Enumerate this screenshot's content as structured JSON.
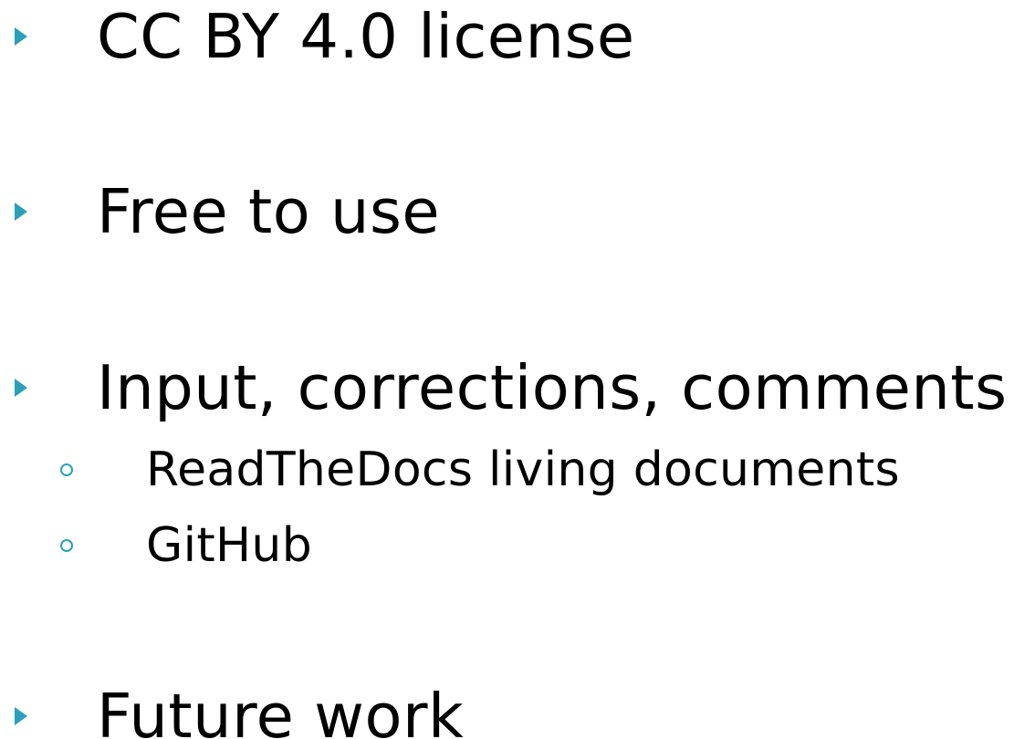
{
  "slide": {
    "bullets": [
      {
        "label": "CC BY 4.0 license"
      },
      {
        "label": "Free to use"
      },
      {
        "label": "Input, corrections, comments",
        "subitems": [
          "ReadTheDocs living documents",
          "GitHub"
        ]
      },
      {
        "label": "Future work"
      }
    ],
    "accent_color": "#2aa0b8",
    "bullet_icon": "triangle-right-icon",
    "subbullet_icon": "circle-outline-icon"
  }
}
